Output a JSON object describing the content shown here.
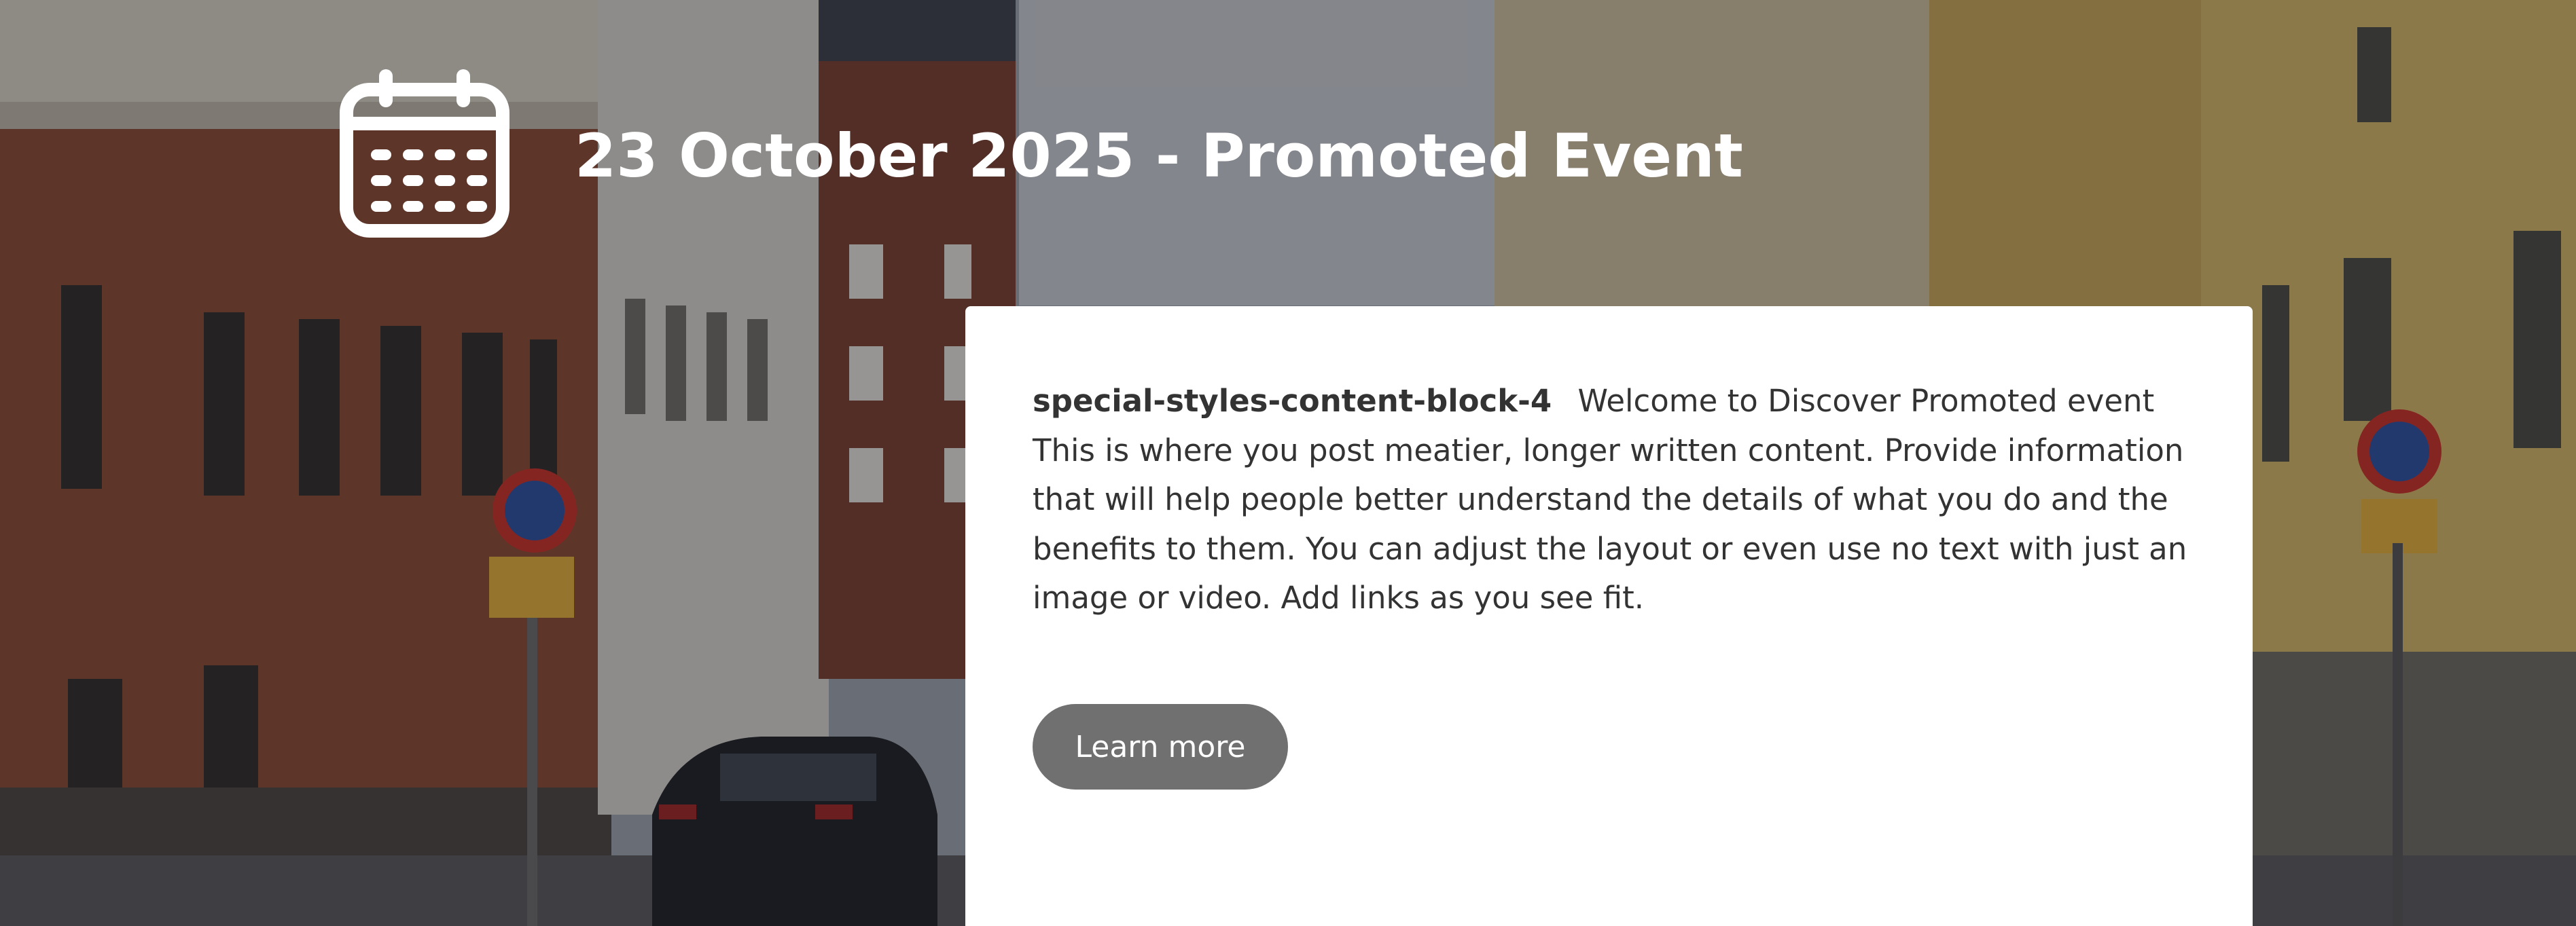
{
  "header": {
    "icon": "calendar-icon",
    "title": "23 October 2025 - Promoted Event"
  },
  "content_block": {
    "label": "special-styles-content-block-4",
    "body": "Welcome to Discover Promoted event This is where you post meatier, longer written content. Provide information that will help people better understand the details of what you do and the benefits to them. You can adjust the layout or even use no text with just an image or video. Add links as you see fit.",
    "button_label": "Learn more"
  },
  "colors": {
    "card_bg": "#ffffff",
    "button_bg": "#707070",
    "button_text": "#ffffff",
    "title_text": "#ffffff",
    "body_text": "#333333"
  }
}
